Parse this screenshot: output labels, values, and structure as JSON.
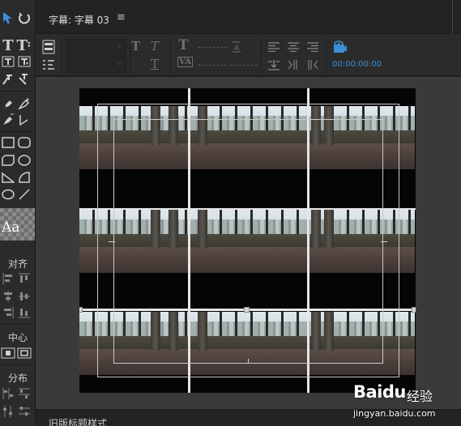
{
  "panel": {
    "title": "字幕: 字幕 03",
    "menu_icon": "≡"
  },
  "toolbar": {
    "timecode": "00:00:00:00",
    "text_glyph_bold": "T",
    "text_glyph_italic": "T",
    "text_glyph_underline": "T",
    "font_size_glyph": "T",
    "kerning_glyph": "VA"
  },
  "tools": {
    "align_section": "对齐",
    "center_section": "中心",
    "distribute_section": "分布",
    "style_swatch_text": "Aa"
  },
  "bottom": {
    "label": "旧版标题样式"
  },
  "watermark": {
    "logo": "Baidu",
    "brand": "经验",
    "url": "jingyan.baidu.com"
  },
  "icons": [
    "selection-tool-icon",
    "rotation-tool-icon",
    "type-tool-icon",
    "vertical-type-tool-icon",
    "area-type-tool-icon",
    "vertical-area-type-tool-icon",
    "path-type-tool-icon",
    "vertical-path-type-tool-icon",
    "pen-tool-icon",
    "add-anchor-icon",
    "delete-anchor-icon",
    "convert-anchor-icon",
    "rectangle-tool-icon",
    "rounded-rectangle-tool-icon",
    "clipped-corner-icon",
    "rounded-corner-icon",
    "wedge-tool-icon",
    "arc-tool-icon",
    "ellipse-tool-icon",
    "line-tool-icon",
    "roll-crawl-icon",
    "tab-stops-icon",
    "show-background-video-icon"
  ]
}
